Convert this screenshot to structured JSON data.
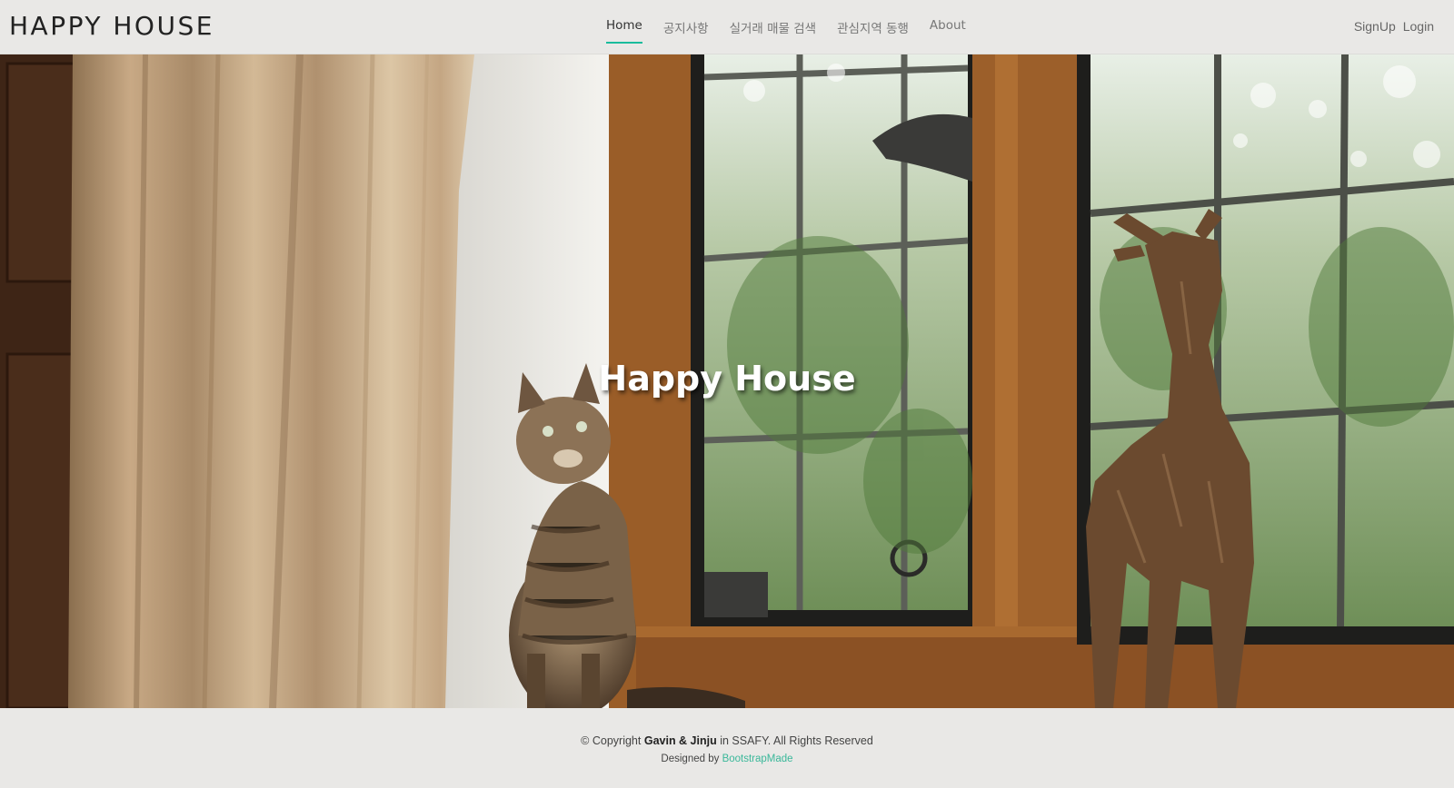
{
  "header": {
    "logo": "HAPPY HOUSE",
    "nav": [
      {
        "label": "Home",
        "active": true
      },
      {
        "label": "공지사항",
        "active": false
      },
      {
        "label": "실거래 매물 검색",
        "active": false
      },
      {
        "label": "관심지역 동행",
        "active": false
      },
      {
        "label": "About",
        "active": false
      }
    ],
    "signup": "SignUp",
    "login": "Login"
  },
  "hero": {
    "title": "Happy House"
  },
  "footer": {
    "copyright_prefix": "© Copyright",
    "copyright_owner": "Gavin & Jinju",
    "copyright_suffix": "in SSAFY. All Rights Reserved",
    "designed_by": "Designed by",
    "designer": "BootstrapMade"
  },
  "colors": {
    "accent": "#1abc9c",
    "link": "#3bb89a",
    "header_bg": "#e9e8e6"
  }
}
